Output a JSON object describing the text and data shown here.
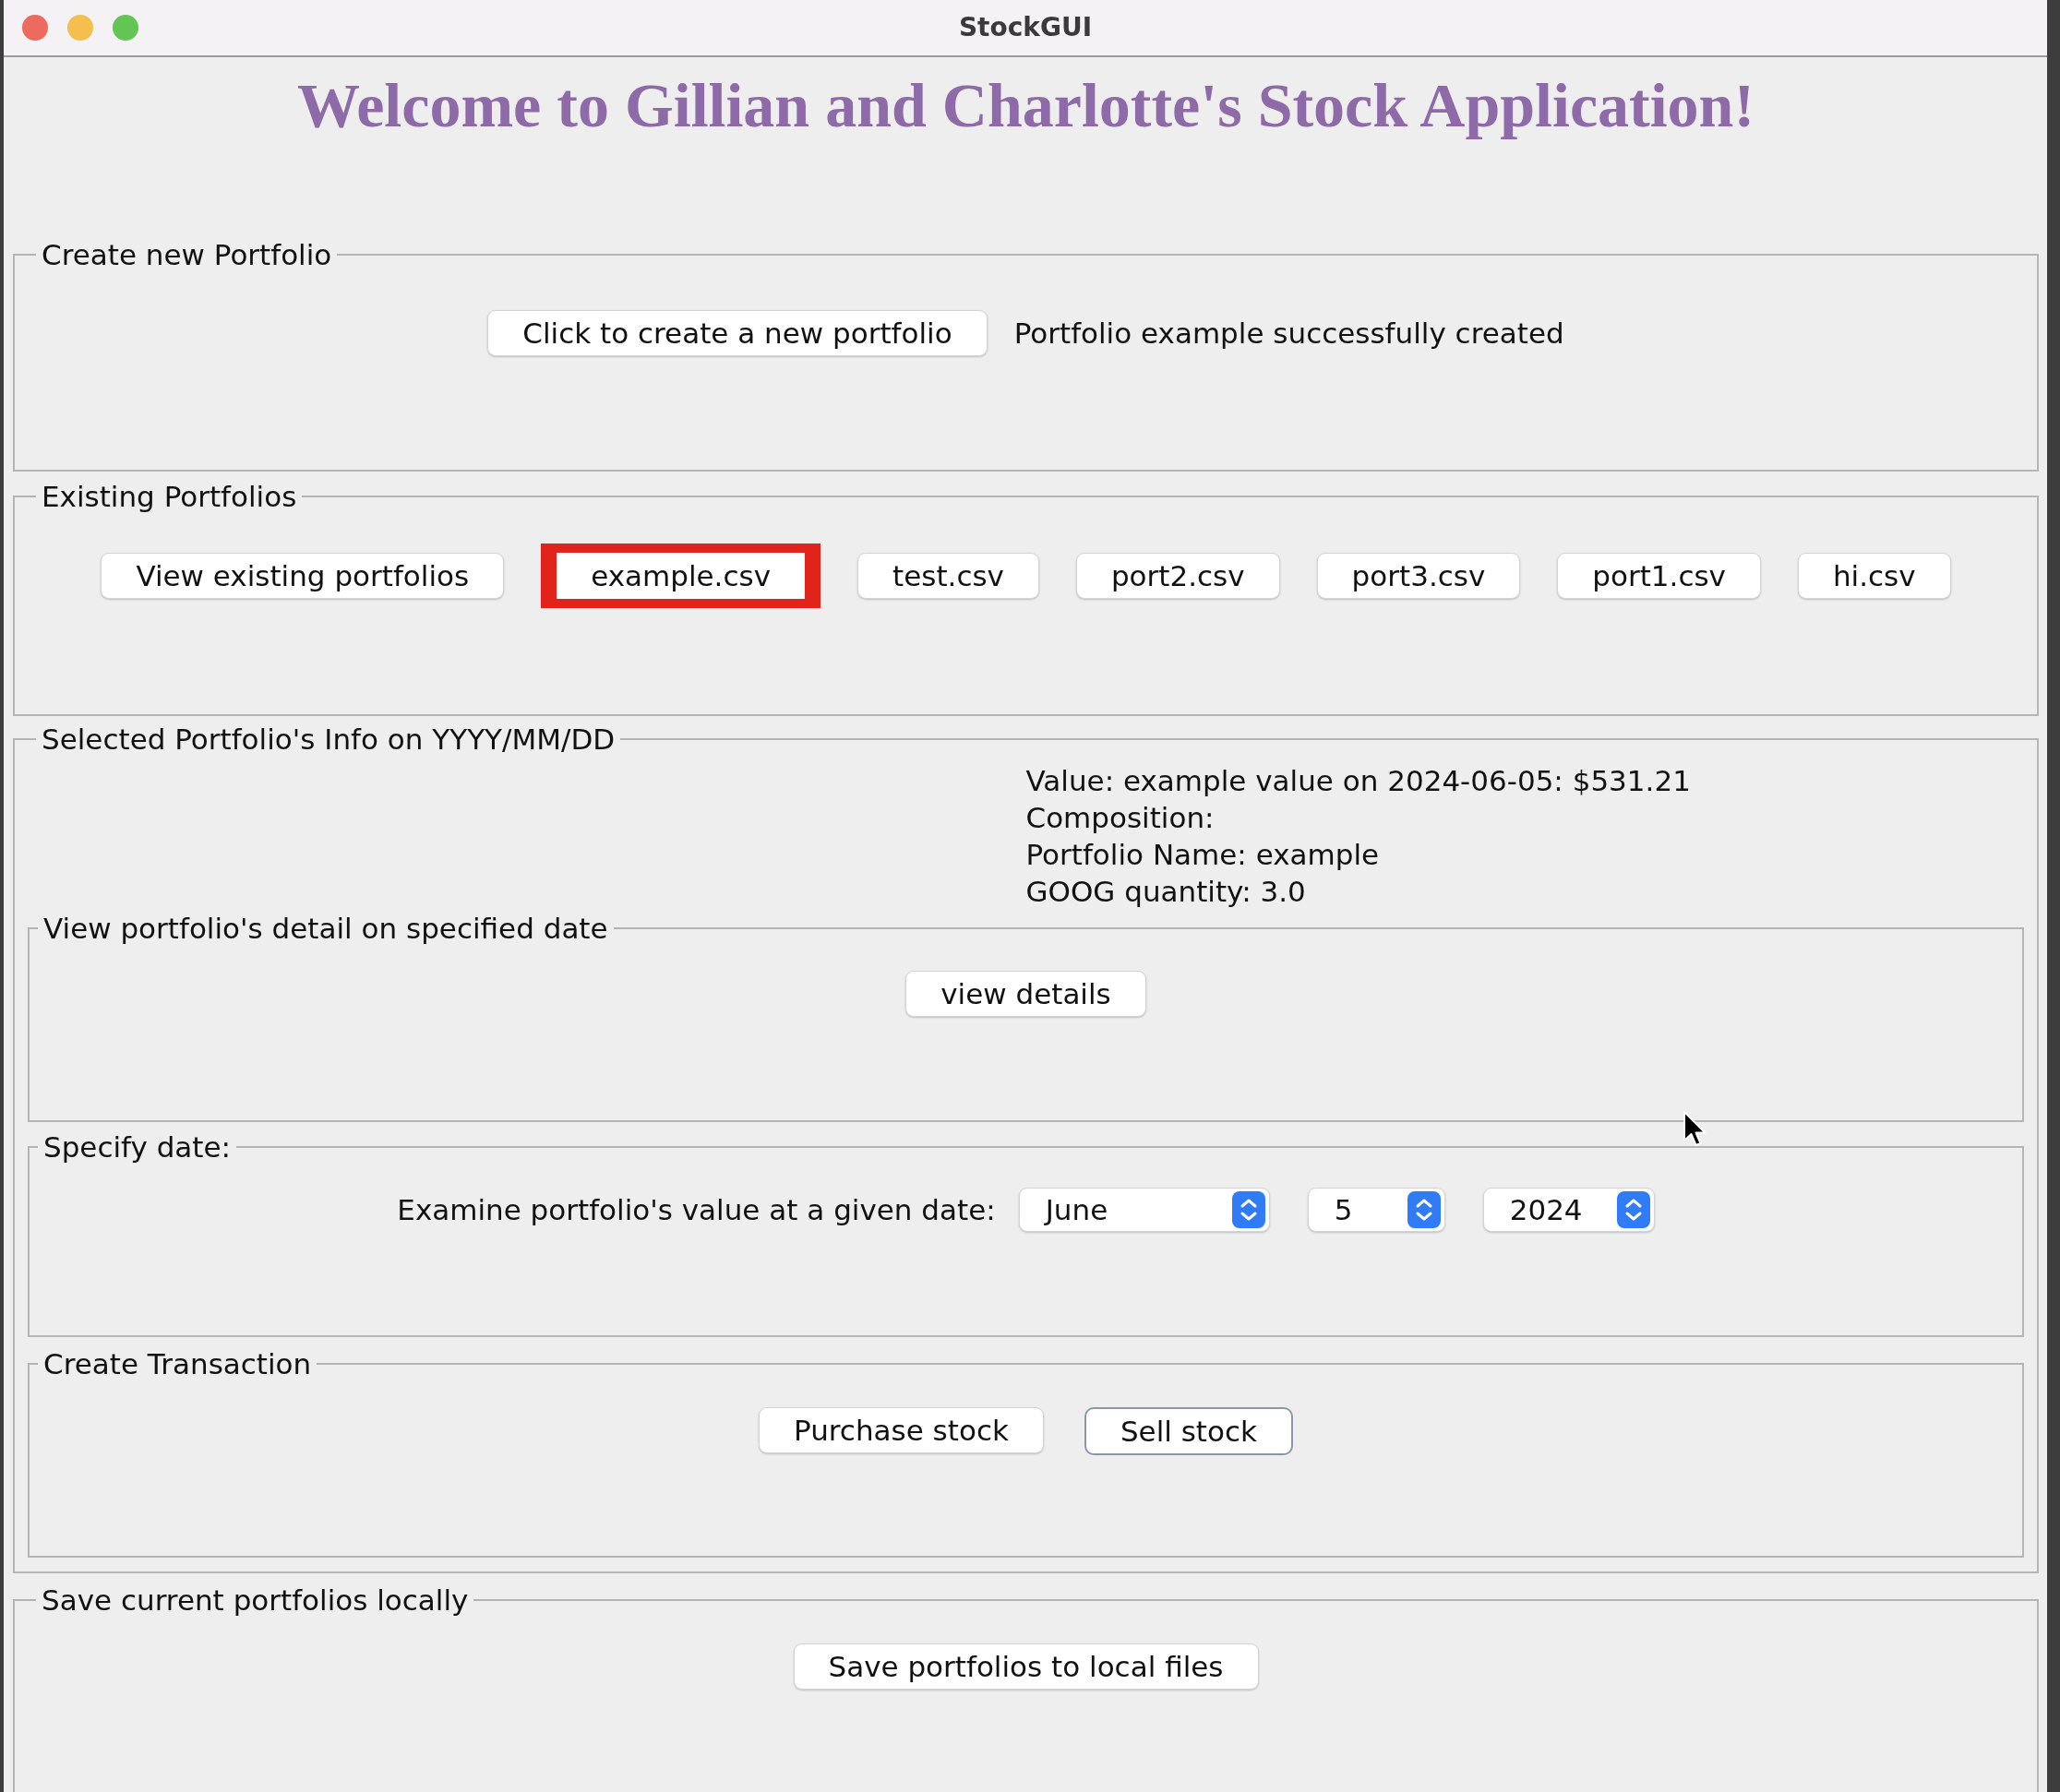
{
  "window": {
    "title": "StockGUI"
  },
  "heading": "Welcome to Gillian and Charlotte's Stock Application!",
  "create_portfolio": {
    "title": "Create new Portfolio",
    "button": "Click to create a new portfolio",
    "status": "Portfolio example successfully created"
  },
  "existing_portfolios": {
    "title": "Existing Portfolios",
    "view_button": "View existing portfolios",
    "portfolios": [
      {
        "label": "example.csv",
        "selected": true
      },
      {
        "label": "test.csv",
        "selected": false
      },
      {
        "label": "port2.csv",
        "selected": false
      },
      {
        "label": "port3.csv",
        "selected": false
      },
      {
        "label": "port1.csv",
        "selected": false
      },
      {
        "label": "hi.csv",
        "selected": false
      }
    ]
  },
  "selected_info": {
    "title": "Selected Portfolio's Info on YYYY/MM/DD",
    "lines": [
      "Value: example value on 2024-06-05: $531.21",
      "Composition:",
      "Portfolio Name: example",
      "GOOG quantity: 3.0"
    ],
    "detail": {
      "title": "View portfolio's detail on specified date",
      "button": "view details"
    },
    "date": {
      "title": "Specify date:",
      "label": "Examine portfolio's value at a given date:",
      "selectors": [
        {
          "value": "June"
        },
        {
          "value": "5"
        },
        {
          "value": "2024"
        }
      ]
    },
    "transaction": {
      "title": "Create Transaction",
      "buttons": [
        {
          "label": "Purchase stock",
          "focused": false
        },
        {
          "label": "Sell stock",
          "focused": true
        }
      ]
    }
  },
  "save": {
    "title": "Save current portfolios locally",
    "button": "Save portfolios to local files"
  }
}
